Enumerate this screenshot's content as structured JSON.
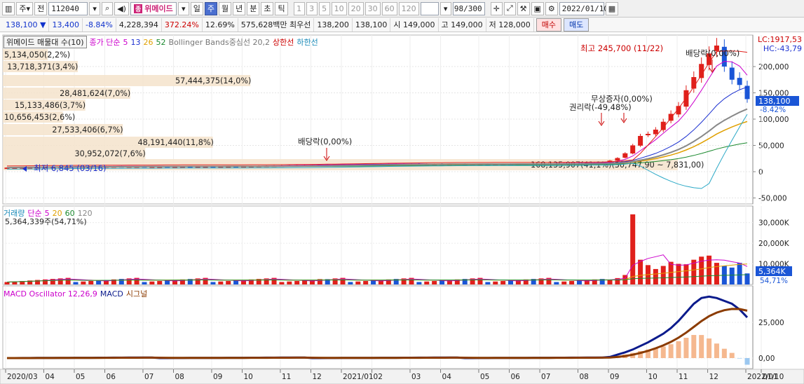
{
  "toolbar": {
    "type_label": "주",
    "market_label": "전",
    "code": "112040",
    "name": "위메이드",
    "name_mark": "종",
    "periods": [
      "일",
      "주",
      "월",
      "년",
      "분",
      "초",
      "틱"
    ],
    "active_period": "주",
    "intervals": [
      "1",
      "3",
      "5",
      "10",
      "20",
      "30",
      "60",
      "120"
    ],
    "count": "98/300",
    "date": "2022/01/10"
  },
  "quote": {
    "price": "138,100",
    "change": "13,400",
    "change_rate": "-8.84%",
    "volume": "4,228,394",
    "vol_ratio": "372.24%",
    "turnover": "12.69%",
    "amount": "575,628백만",
    "best_bid_label": "최우선",
    "best_ask": "138,200",
    "best_bid": "138,100",
    "open_label": "시",
    "open": "149,000",
    "high_label": "고",
    "high": "149,000",
    "low_label": "저",
    "low": "128,000",
    "buy_label": "매수",
    "sell_label": "매도"
  },
  "price_panel": {
    "legend": {
      "title": "위메이드 매물대 수(10)",
      "close_label": "종가 단순",
      "ma": [
        "5",
        "13",
        "26",
        "52"
      ],
      "bb": "Bollinger Bands중심선 20,2",
      "upper": "상한선",
      "lower": "하한선"
    },
    "lc": "LC:1917,53",
    "hc": "HC:-43,79",
    "last_price": "138,100",
    "last_rate": "-8.42%",
    "yticks": [
      "200,000",
      "150,000",
      "100,000",
      "50,000",
      "0",
      "-50,000"
    ],
    "volume_profile": [
      {
        "label": "5,134,050(2,2%)",
        "frac": 0.06
      },
      {
        "label": "13,718,371(3,4%)",
        "frac": 0.1
      },
      {
        "label": "57,444,375(14,0%)",
        "frac": 0.33
      },
      {
        "label": "28,481,624(7,0%)",
        "frac": 0.17
      },
      {
        "label": "15,133,486(3,7%)",
        "frac": 0.11
      },
      {
        "label": "10,656,453(2,6%)",
        "frac": 0.08
      },
      {
        "label": "27,533,406(6,7%)",
        "frac": 0.16
      },
      {
        "label": "48,191,440(11,8%)",
        "frac": 0.28
      },
      {
        "label": "30,952,072(7,6%)",
        "frac": 0.19
      },
      {
        "label": "168,135,907(41,1%)(30,747,90 ~ 7,831,00)",
        "frac": 0.9
      }
    ],
    "annotations": {
      "high": "최고 245,700 (11/22)",
      "low": "최저 6,845 (03/16)",
      "dividend1": "배당락(0,00%)",
      "dividend2": "배당락(0,00%)",
      "rights": "권리락(-49,48%)",
      "free_issue": "무상증자(0,00%)"
    }
  },
  "volume_panel": {
    "legend_label": "거래량",
    "ma_label": "단순",
    "ma": [
      "5",
      "20",
      "60",
      "120"
    ],
    "current": "5,364,339주(54,71%)",
    "yticks": [
      "30,000K",
      "20,000K",
      "10,000K"
    ],
    "last": "5,364K",
    "last_rate": "54,71%"
  },
  "macd_panel": {
    "legend": "MACD Oscillator 12,26,9",
    "macd": "MACD",
    "signal": "시그널",
    "yticks": [
      "25,000",
      "0,00"
    ]
  },
  "xaxis": [
    "2020/03",
    "04",
    "05",
    "06",
    "07",
    "08",
    "09",
    "10",
    "11",
    "12",
    "2021/01",
    "02",
    "03",
    "04",
    "05",
    "06",
    "07",
    "08",
    "09",
    "10",
    "11",
    "12",
    "2022/01",
    "01/10"
  ],
  "colors": {
    "up": "#e0201b",
    "down": "#1a55d6",
    "ma5": "#cc00cc",
    "ma13": "#1a2fd0",
    "ma26": "#e0a000",
    "ma52": "#1b8a2f",
    "bb_mid": "#888888",
    "bb_lower": "#2aa8c6",
    "macd": "#0b1b8c",
    "signal": "#8b3b00",
    "osc_pos": "#f5b88f",
    "osc_neg": "#9cc8f0",
    "profile": "#f4e3cb"
  }
}
